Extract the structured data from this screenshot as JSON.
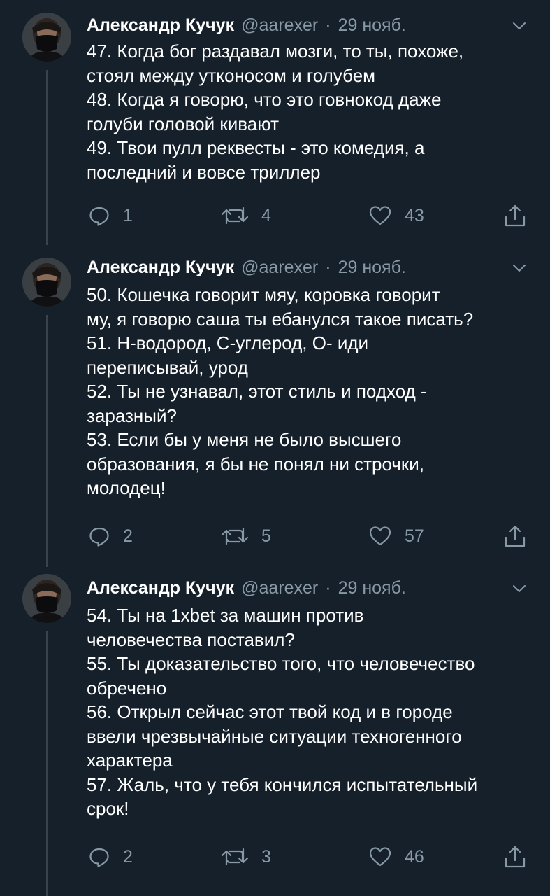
{
  "colors": {
    "background": "#15202b",
    "text": "#ffffff",
    "secondary": "#8899a6",
    "thread_line": "#38444d"
  },
  "tweets": [
    {
      "author": "Александр Кучук",
      "handle": "@aarexer",
      "date": "29 нояб.",
      "lines": [
        "47. Когда бог раздавал мозги, то ты, похоже,",
        "стоял между утконосом и голубем",
        "48. Когда я говорю, что это говнокод даже",
        "голуби головой кивают",
        "49. Твои пулл реквесты - это комедия, а",
        "последний и вовсе триллер"
      ],
      "replies": "1",
      "retweets": "4",
      "likes": "43"
    },
    {
      "author": "Александр Кучук",
      "handle": "@aarexer",
      "date": "29 нояб.",
      "lines": [
        "50. Кошечка говорит мяу, коровка говорит",
        "му, я говорю саша ты ебанулся такое писать?",
        "51. Н-водород, С-углерод, О- иди",
        "переписывай, урод",
        "52. Ты не узнавал, этот стиль и подход -",
        "заразный?",
        "53. Если бы у меня не было высшего",
        "образования, я бы не понял ни строчки,",
        "молодец!"
      ],
      "replies": "2",
      "retweets": "5",
      "likes": "57"
    },
    {
      "author": "Александр Кучук",
      "handle": "@aarexer",
      "date": "29 нояб.",
      "lines": [
        "54. Ты на 1xbet за машин против",
        "человечества поставил?",
        "55. Ты доказательство того, что человечество",
        "обречено",
        "56. Открыл сейчас этот твой код и в городе",
        "ввели чрезвычайные ситуации техногенного",
        "характера",
        "57. Жаль, что у тебя кончился испытательный",
        "срок!"
      ],
      "replies": "2",
      "retweets": "3",
      "likes": "46"
    }
  ]
}
